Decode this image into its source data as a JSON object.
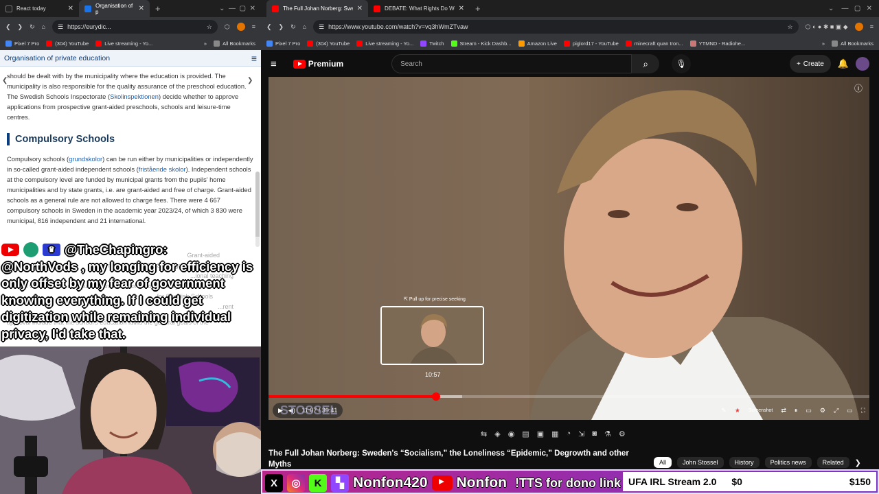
{
  "left_browser": {
    "tabs": [
      {
        "title": "React today",
        "active": false,
        "color": "#1f1f1f"
      },
      {
        "title": "Organisation of p",
        "active": true,
        "color": "#1a73e8"
      }
    ],
    "url": "https://eurydic...",
    "bookmarks": [
      "Pixel 7 Pro",
      "(304) YouTube",
      "Live streaming - Yo...",
      "All Bookmarks"
    ],
    "site_heading": "Organisation of private education",
    "para1": "should be dealt with by the municipality where the education is provided. The municipality is also responsible for the quality assurance of the preschool education. The Swedish Schools Inspectorate (",
    "para1_link": "Skolinspektionen",
    "para1_end": ") decide whether to approve applications from prospective grant-aided preschools, schools and leisure-time centres.",
    "section_heading": "Compulsory Schools",
    "para2_a": "Compulsory schools (",
    "para2_link1": "grundskolor",
    "para2_b": ") can be run either by municipalities or independently in so-called grant-aided independent schools (",
    "para2_link2": "fristående skolor",
    "para2_c": "). Independent schools at the compulsory level are funded by municipal grants from the pupils' home municipalities and by state grants, i.e. are grant-aided and free of charge. Grant-aided schools as a general rule are not allowed to charge fees. There were 4 667 compulsory schools in Sweden in the academic year 2023/24, of which 3 830 were municipal, 816 independent and 21 international.",
    "ghost_lines": [
      "Grant-aided",
      "academic year 2023/24. Some grant-aided",
      "...ional teaching",
      "schools with a certain religious denomination or schools run by",
      "...for Swedish Schools",
      "...rent",
      "approval include that the school's education fulfils the general goals of the"
    ]
  },
  "chat": {
    "username": "@TheChapingro:",
    "message": "@NorthVods , my longing for efficiency is only offset by my fear of government knowing everything. If I could get digitization while remaining individual privacy, I'd take that."
  },
  "right_browser": {
    "tabs": [
      {
        "title": "The Full Johan Norberg: Swede",
        "active": true
      },
      {
        "title": "DEBATE: What Rights Do We H",
        "active": false
      }
    ],
    "url": "https://www.youtube.com/watch?v=vq3hWmZTvaw",
    "bookmarks": [
      "Pixel 7 Pro",
      "(304) YouTube",
      "Live streaming - Yo...",
      "Twitch",
      "Stream - Kick Dashb...",
      "Amazon Live",
      "piglord17 - YouTube",
      "minecraft quan tron...",
      "YTMND - Radiohe...",
      "All Bookmarks"
    ]
  },
  "youtube": {
    "logo": "Premium",
    "search_placeholder": "Search",
    "create_label": "Create",
    "seek_hint": "Pull up for precise seeking",
    "seek_time": "10:57",
    "time_display": "11:07 / 39:41",
    "watermark": "STOSSEL",
    "progress": {
      "played_fraction": 0.279,
      "buffered_fraction": 0.322
    },
    "video_title": "The Full Johan Norberg: Sweden's “Socialism,” the Loneliness “Epidemic,” Degrowth and other Myths",
    "screenshot_label": "Screenshot",
    "chips": [
      "All",
      "John Stossel",
      "History",
      "Politics news",
      "Related"
    ]
  },
  "banner": {
    "handle1": "Nonfon420",
    "handle2": "Nonfon",
    "tts": "!TTS for dono link",
    "goal_title": "UFA IRL Stream 2.0",
    "goal_current": "$0",
    "goal_target": "$150"
  }
}
